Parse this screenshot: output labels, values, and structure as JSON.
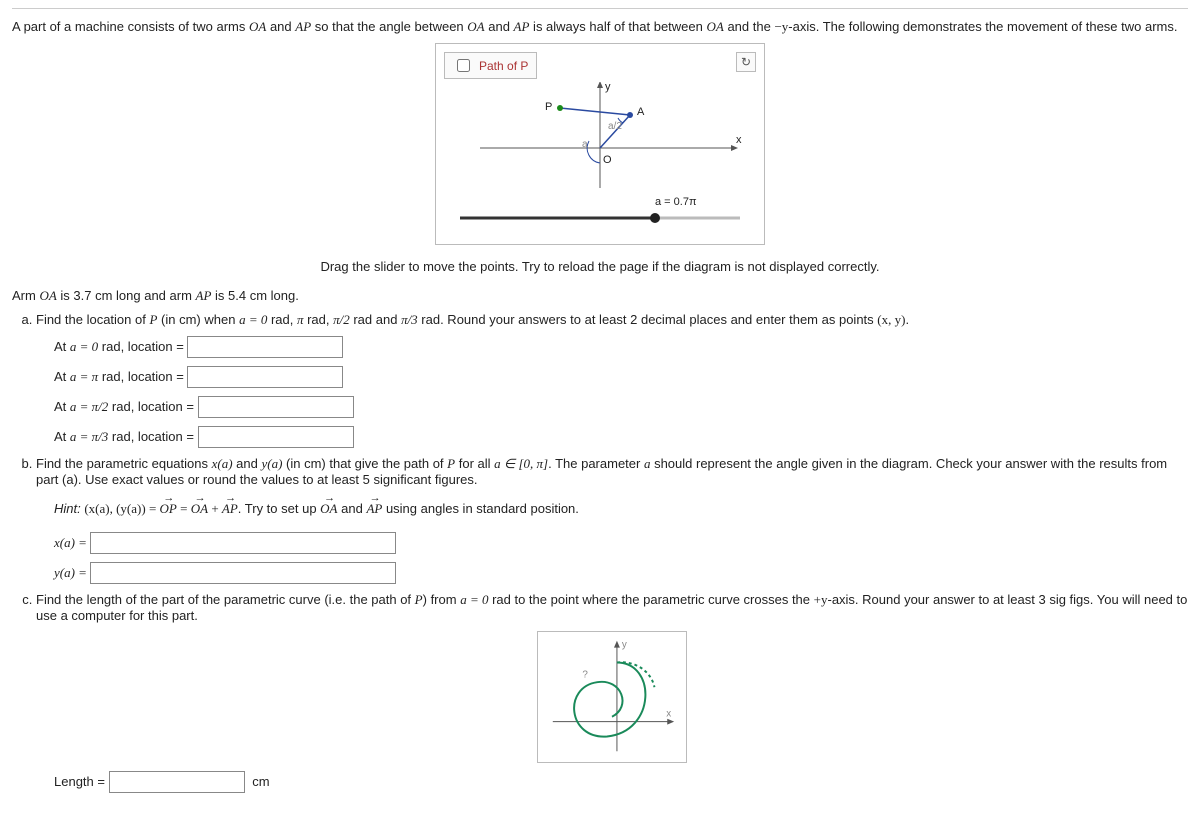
{
  "intro": {
    "p1a": "A part of a machine consists of two arms ",
    "oa": "OA",
    "p1b": " and ",
    "ap": "AP",
    "p1c": " so that the angle between ",
    "p1d": " and ",
    "p1e": " is always half of that between ",
    "p1f": " and the ",
    "negy": "−y",
    "p1g": "-axis. The following demonstrates the movement of these two arms."
  },
  "diagram": {
    "pathp_label": "Path of P",
    "y": "y",
    "x": "x",
    "P": "P",
    "A": "A",
    "O": "O",
    "a": "a",
    "ahalf": "a/2",
    "slider_label": "a = 0.7π"
  },
  "drag_note": "Drag the slider to move the points. Try to reload the page if the diagram is not displayed correctly.",
  "arm_lengths": {
    "prefix": "Arm ",
    "mid1": " is 3.7 cm long and arm ",
    "mid2": " is 5.4 cm long."
  },
  "partA": {
    "q1": "Find the location of ",
    "P": "P",
    "q2": " (in cm) when ",
    "aeq": "a = 0",
    "q3": " rad, ",
    "pi": "π",
    "q4": " rad, ",
    "pihalf": "π/2",
    "q5": " rad and ",
    "pithird": "π/3",
    "q6": " rad. Round your answers to at least 2 decimal places and enter them as points ",
    "xy": "(x, y)",
    "period": ".",
    "rows": [
      {
        "pre": "At ",
        "aexpr": "a = 0",
        "post": " rad, location ="
      },
      {
        "pre": "At ",
        "aexpr": "a = π",
        "post": " rad, location ="
      },
      {
        "pre": "At ",
        "aexpr": "a = π/2",
        "post": " rad, location ="
      },
      {
        "pre": "At ",
        "aexpr": "a = π/3",
        "post": " rad, location ="
      }
    ]
  },
  "partB": {
    "q1": "Find the parametric equations ",
    "xa": "x(a)",
    "q2": " and ",
    "ya": "y(a)",
    "q3": " (in cm) that give the path of ",
    "P": "P",
    "q4": " for all ",
    "ain": "a ∈ [0, π]",
    "q5": ". The parameter ",
    "a": "a",
    "q6": " should represent the angle given in the diagram. Check your answer with the results from part (a). Use exact values or round the values to at least 5 significant figures.",
    "hint_label": "Hint:  ",
    "hint_a": "(x(a), (y(a)) = ",
    "op": "OP",
    "eq": " = ",
    "oa": "OA",
    "plus": " + ",
    "ap": "AP",
    "hint_b": ".  Try to set up ",
    "hint_c": " and ",
    "hint_d": " using angles in standard position.",
    "xa_lbl": "x(a) = ",
    "ya_lbl": "y(a) = "
  },
  "partC": {
    "q1": "Find the length of the part of the parametric curve (i.e. the path of ",
    "P": "P",
    "q2": ") from ",
    "a0": "a = 0",
    "q3": " rad to the point where the parametric curve crosses the ",
    "py": "+y",
    "q4": "-axis. Round your answer to at least 3 sig figs. You will need to use a computer for this part.",
    "length_label": "Length = ",
    "unit": "cm"
  },
  "diagram2": {
    "y": "y",
    "x": "x",
    "q": "?"
  }
}
